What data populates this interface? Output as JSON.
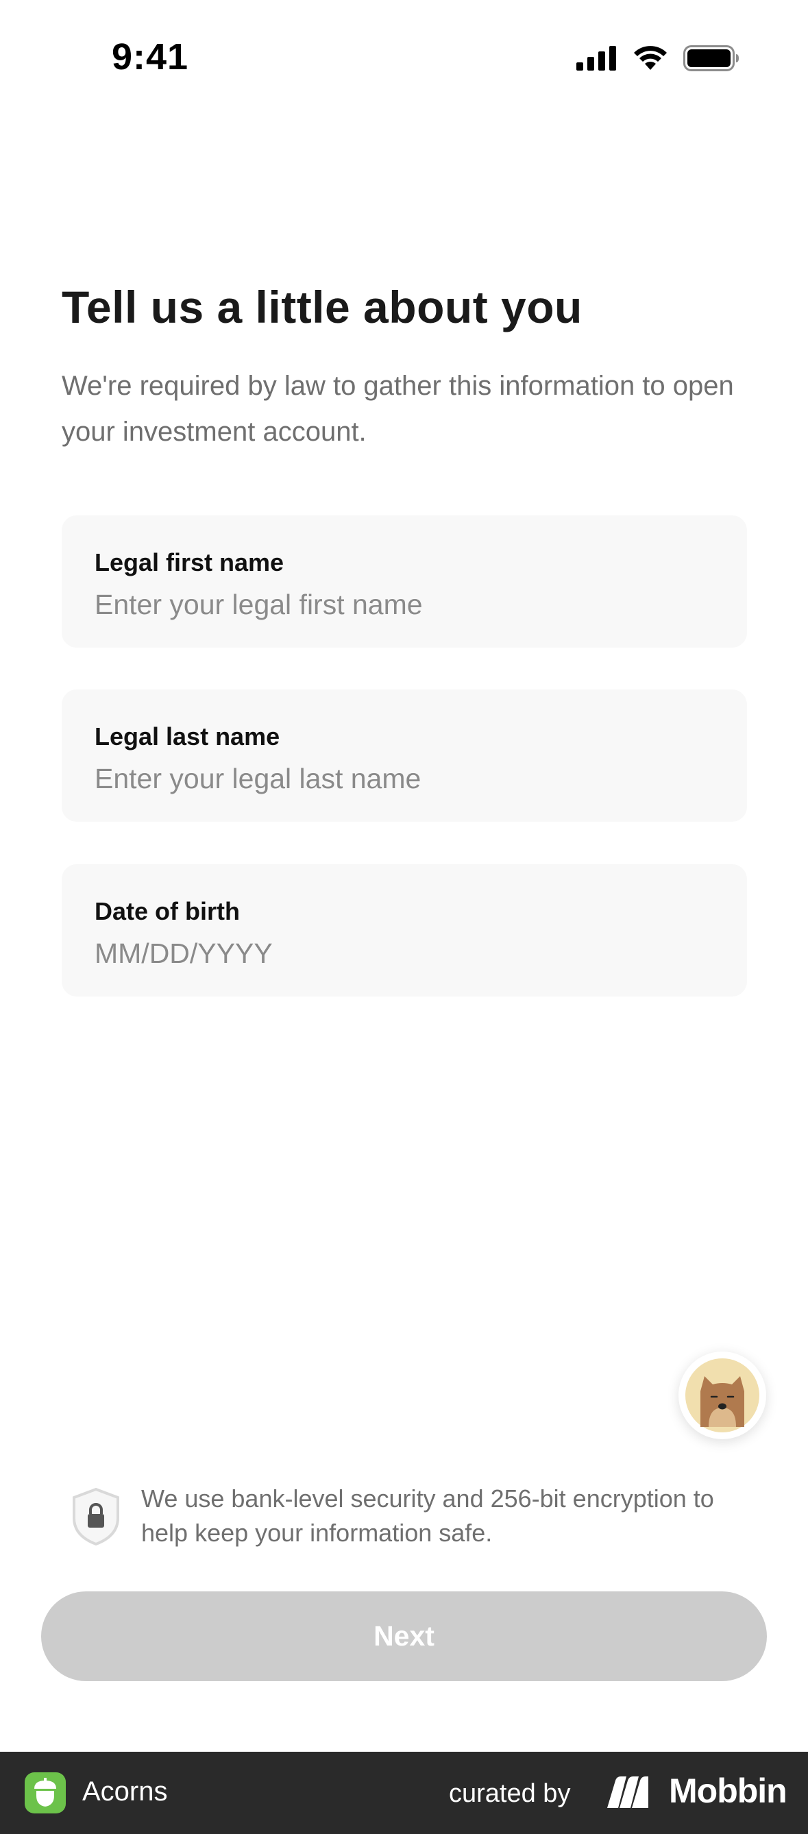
{
  "status_bar": {
    "time": "9:41"
  },
  "form": {
    "title": "Tell us a little about you",
    "subtitle": "We're required by law to gather this information to open your investment account.",
    "fields": [
      {
        "label": "Legal first name",
        "value": "",
        "placeholder": "Enter your legal first name"
      },
      {
        "label": "Legal last name",
        "value": "",
        "placeholder": "Enter your legal last name"
      },
      {
        "label": "Date of birth",
        "value": "",
        "placeholder": "MM/DD/YYYY"
      }
    ]
  },
  "security": {
    "text": "We use bank-level security and 256-bit encryption to help keep your information safe.",
    "icon": "shield-lock-icon"
  },
  "next_button": {
    "label": "Next",
    "enabled": false
  },
  "footer": {
    "app_name": "Acorns",
    "curated_label": "curated by",
    "brand": "Mobbin"
  },
  "colors": {
    "button_disabled": "#cccccc",
    "field_background": "#f8f8f8",
    "footer_background": "#2a2a2a",
    "acorns_green": "#6cc24a"
  }
}
